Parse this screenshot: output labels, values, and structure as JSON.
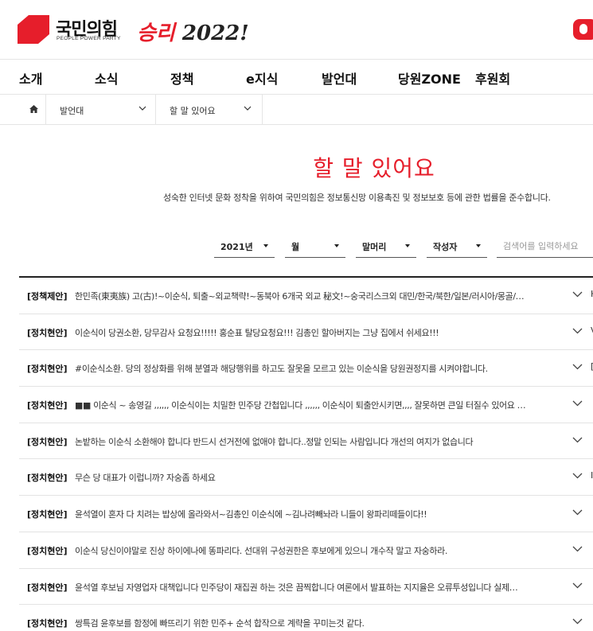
{
  "header": {
    "logo_name": "국민의힘",
    "logo_sub": "PEOPLE POWER PARTY",
    "slogan_part1": "승리",
    "slogan_part2": " 2022!",
    "brand_color": "#e61e2b"
  },
  "gnb": {
    "items": [
      "소개",
      "소식",
      "정책",
      "e지식",
      "발언대",
      "당원ZONE",
      "후원회"
    ]
  },
  "breadcrumb": {
    "level1": "발언대",
    "level2": "할 말 있어요"
  },
  "page": {
    "title": "할 말 있어요",
    "notice": "성숙한 인터넷 문화 정착을 위하여 국민의힘은 정보통신망 이용촉진 및 정보보호 등에 관한 법률을 준수합니다."
  },
  "filters": {
    "year": "2021년",
    "month": "월",
    "prefix": "말머리",
    "author": "작성자",
    "search_placeholder": "검색어를 입력하세요"
  },
  "posts": [
    {
      "category": "[정책제안]",
      "title": "한민족(東夷族) 고(古)!~이순식, 퇴출~외교책략!~동북아 6개국 외교 秘文!~숭국리스크외 대민/한국/북한/일본/러시아/몽골/…",
      "extra": "H"
    },
    {
      "category": "[정치현안]",
      "title": "이순식이 당권소환, 당무감사 요청요!!!!! 홍순표 탈당요청요!!! 김총인 할아버지는 그냥 집에서 쉬세요!!!",
      "extra": "V"
    },
    {
      "category": "[정치현안]",
      "title": "#이순식소환. 당의 정상화를 위해 분열과 해당행위를 하고도 잘못을 모르고 있는 이순식을 당원권정지를 시켜야합니다.",
      "extra": "[]"
    },
    {
      "category": "[정치현안]",
      "title": "■■ 이순식 ~ 송영길 ,,,,,, 이순식이는 치밀한 민주당 간첩입니다 ,,,,,, 이순식이 퇴출안시키면,,,, 잘못하면 큰일 터질수 있어요 …",
      "extra": ""
    },
    {
      "category": "[정치현안]",
      "title": "논밭하는 이순식 소환해야 합니다 반드시 선거전에 없애야 합니다..정말 인되는 사람입니다 개선의 여지가 없습니다",
      "extra": ""
    },
    {
      "category": "[정치현안]",
      "title": "무슨 당 대표가 이럽니까? 자숭좀 하세요",
      "extra": "I"
    },
    {
      "category": "[정치현안]",
      "title": "윤석열이 혼자 다 치려는 밥상에 올라와서~김총인 이순식에 ~김나려빼놔라 니들이 왕파리떼들이다!!",
      "extra": ""
    },
    {
      "category": "[정치현안]",
      "title": "이순식 당신이야말로 진상 하이에나에 똥파리다. 선대위 구성권한은 후보에게 있으니 개수작 말고 자숭하라.",
      "extra": ""
    },
    {
      "category": "[정치현안]",
      "title": "윤석열 후보님 자영업자 대책입니다 민주당이 재집권 하는 것은 끔찍합니다 여론에서 발표하는 지지율은 오류투성입니다 실제…",
      "extra": ""
    },
    {
      "category": "[정치현안]",
      "title": "쌍특검 윤후보를 함정에 빠뜨리기 위한 민주+ 순석 합작으로 계략을 꾸미는것 같다.",
      "extra": ""
    }
  ]
}
